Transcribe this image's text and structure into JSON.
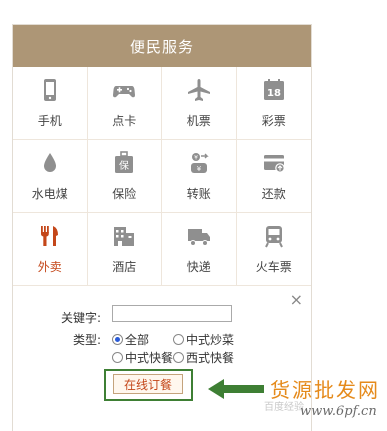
{
  "panel": {
    "title": "便民服务",
    "tiles": [
      {
        "label": "手机",
        "icon": "mobile-phone-icon"
      },
      {
        "label": "点卡",
        "icon": "gamepad-icon"
      },
      {
        "label": "机票",
        "icon": "airplane-icon"
      },
      {
        "label": "彩票",
        "icon": "lottery-18-icon"
      },
      {
        "label": "水电煤",
        "icon": "water-drop-icon"
      },
      {
        "label": "保险",
        "icon": "insurance-shield-icon"
      },
      {
        "label": "转账",
        "icon": "money-transfer-icon"
      },
      {
        "label": "还款",
        "icon": "credit-card-icon"
      },
      {
        "label": "外卖",
        "icon": "fork-knife-icon",
        "active": true
      },
      {
        "label": "酒店",
        "icon": "hotel-building-icon"
      },
      {
        "label": "快递",
        "icon": "delivery-truck-icon"
      },
      {
        "label": "火车票",
        "icon": "train-icon"
      }
    ]
  },
  "form": {
    "close_icon": "×",
    "keyword_label": "关键字:",
    "keyword_value": "",
    "type_label": "类型:",
    "options": [
      {
        "label": "全部",
        "checked": true
      },
      {
        "label": "中式炒菜",
        "checked": false
      },
      {
        "label": "中式快餐",
        "checked": false
      },
      {
        "label": "西式快餐",
        "checked": false
      }
    ],
    "order_button": "在线订餐"
  },
  "watermark": {
    "title": "货源批发网",
    "url": "www.6pf.cn",
    "faint": "百度经验"
  },
  "colors": {
    "header": "#ad9676",
    "icon": "#8f8f8f",
    "active": "#c4471a",
    "highlight_box": "#3e7f34",
    "watermark": "#e58a1b"
  }
}
